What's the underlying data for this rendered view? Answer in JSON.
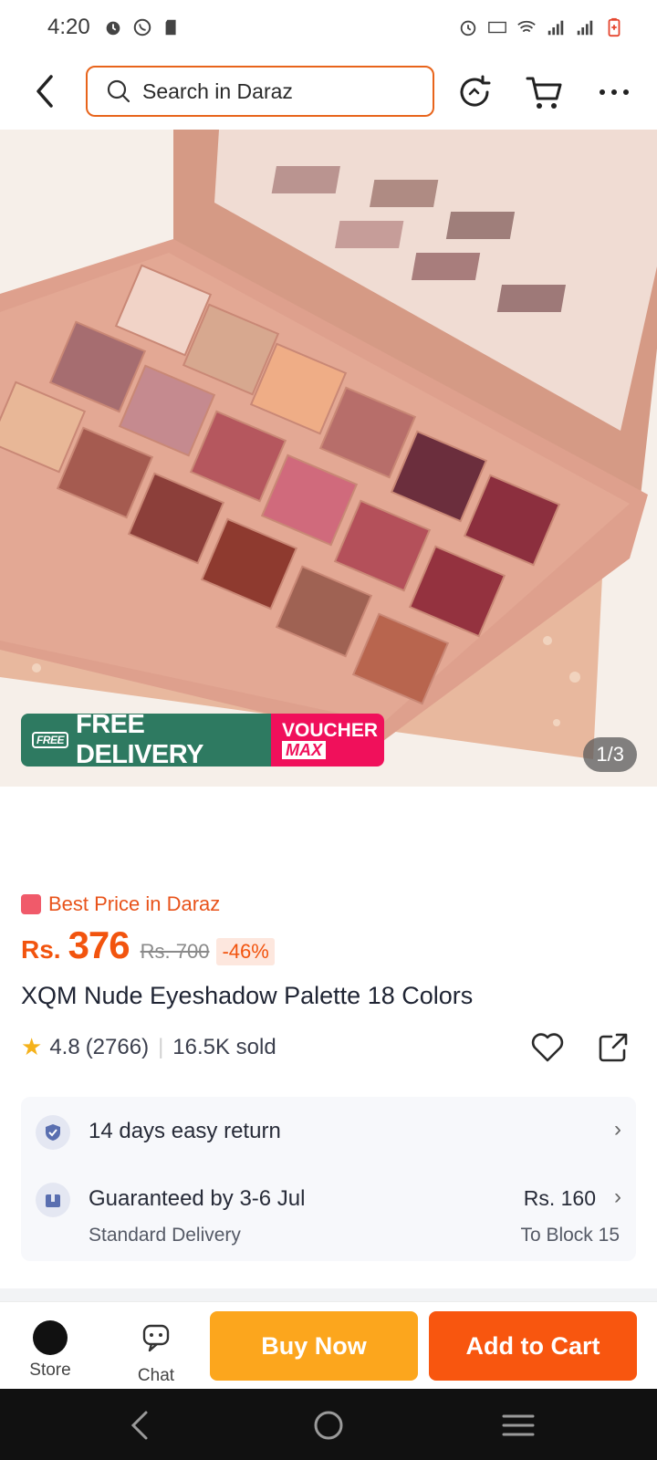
{
  "status_bar": {
    "time": "4:20"
  },
  "search": {
    "placeholder": "Search in Daraz"
  },
  "icons": {
    "back": "back-arrow-icon",
    "search": "search-icon",
    "refresh": "refresh-icon",
    "cart": "cart-icon",
    "more": "more-dots-icon",
    "heart": "heart-icon",
    "share": "share-icon"
  },
  "image": {
    "free_tag": "FREE",
    "free_delivery": "FREE DELIVERY",
    "voucher_line1": "VOUCHER",
    "voucher_line2": "MAX",
    "counter": "1/3"
  },
  "product": {
    "best_price": "Best Price in Daraz",
    "currency": "Rs.",
    "price": "376",
    "old_price": "Rs. 700",
    "discount": "-46%",
    "title": "XQM Nude Eyeshadow Palette 18 Colors",
    "rating": "4.8",
    "reviews": "(2766)",
    "sold": "16.5K sold"
  },
  "services": {
    "return_label": "14 days easy return",
    "delivery_label": "Guaranteed by 3-6 Jul",
    "delivery_type": "Standard Delivery",
    "delivery_fee": "Rs. 160",
    "delivery_location": "To Block 15"
  },
  "actions": {
    "store": "Store",
    "chat": "Chat",
    "buy_now": "Buy Now",
    "add_to_cart": "Add to Cart"
  },
  "colors": {
    "brand_orange": "#f8560f",
    "buy_now_yellow": "#fca61d",
    "free_delivery_green": "#2e7a61",
    "voucher_pink": "#f0105b"
  }
}
